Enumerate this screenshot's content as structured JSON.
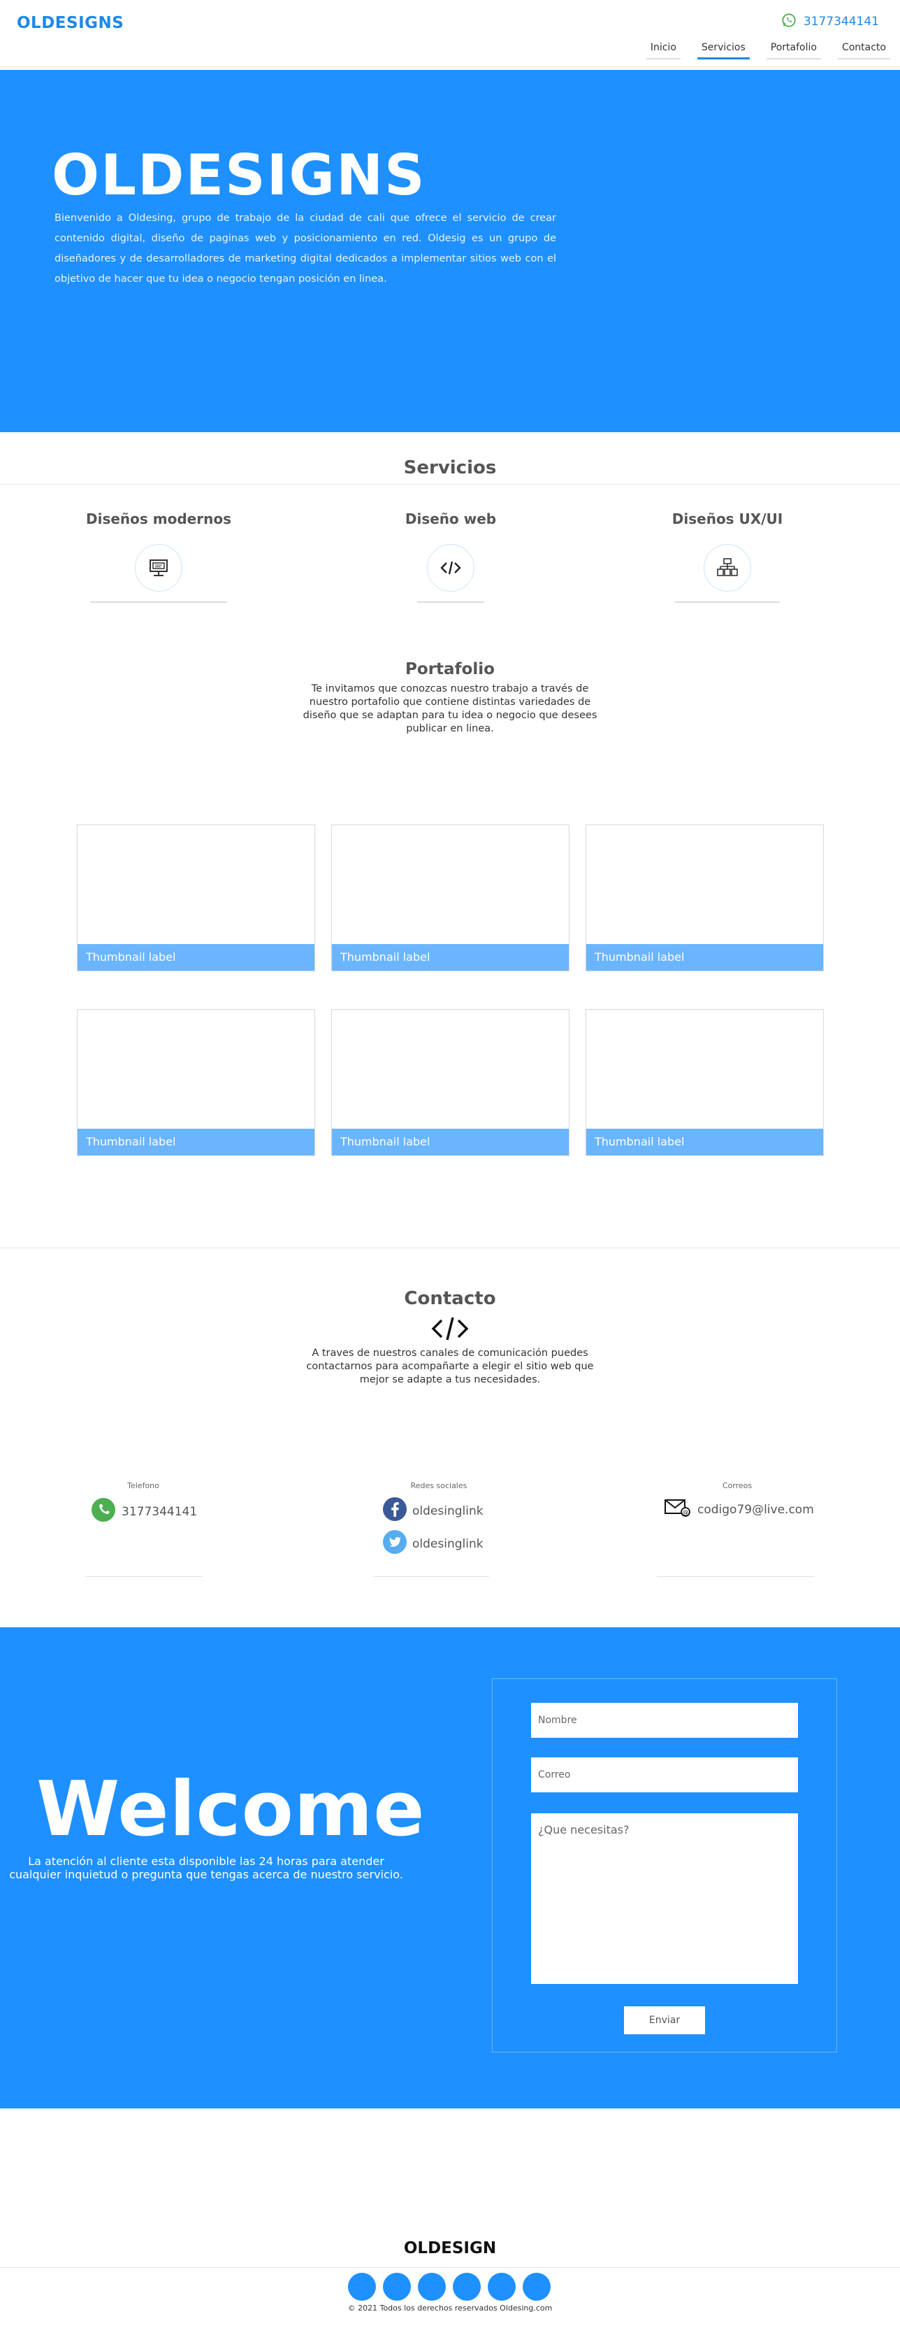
{
  "header": {
    "brand": "OLDESIGNS",
    "phone": "3177344141",
    "nav": [
      "Inicio",
      "Servicios",
      "Portafolio",
      "Contacto"
    ]
  },
  "hero": {
    "title": "OLDESIGNS",
    "text": "Bienvenido a Oldesing, grupo de trabajo de la ciudad de cali que ofrece el servicio de crear contenido digital, diseño de paginas web y posicionamiento en red. Oldesig es un grupo de diseñadores y de desarrolladores de marketing digital dedicados a implementar sitios web con el objetivo de hacer que tu idea o negocio tengan posición en linea."
  },
  "services": {
    "title": "Servicios",
    "items": [
      {
        "label": "Diseños modernos",
        "icon": "monitor-icon"
      },
      {
        "label": "Diseño web",
        "icon": "code-icon"
      },
      {
        "label": "Diseños UX/UI",
        "icon": "sitemap-icon"
      }
    ]
  },
  "portfolio": {
    "title": "Portafolio",
    "text": "Te invitamos que conozcas nuestro trabajo a través de nuestro portafolio que contiene distintas variedades de diseño que se adaptan para tu idea o negocio que desees publicar en linea.",
    "thumbs": [
      "Thumbnail label",
      "Thumbnail label",
      "Thumbnail label",
      "Thumbnail label",
      "Thumbnail label",
      "Thumbnail label"
    ]
  },
  "contact": {
    "title": "Contacto",
    "text": "A traves de nuestros canales de comunicación puedes contactarnos para acompañarte a elegir el sitio web que mejor se adapte a tus necesidades.",
    "phone_label": "Telefono",
    "phone": "3177344141",
    "social_label": "Redes sociales",
    "facebook": "oldesinglink",
    "twitter": "oldesinglink",
    "mail_label": "Correos",
    "email": "codigo79@live.com"
  },
  "welcome": {
    "title": "Welcome",
    "text": "La atención al cliente esta disponible las 24 horas para atender cualquier inquietud o pregunta que tengas acerca de nuestro servicio.",
    "name_placeholder": "Nombre",
    "email_placeholder": "Correo",
    "message_placeholder": "¿Que necesitas?",
    "submit": "Enviar"
  },
  "footer": {
    "title": "OLDESIGN",
    "copyright": "© 2021 Todos los derechos reservados Oldesing.com"
  },
  "colors": {
    "accent": "#1e90ff",
    "thumb_caption": "#6bb5ff",
    "whatsapp": "#4caf50",
    "facebook": "#3b5998",
    "twitter": "#55acee"
  }
}
